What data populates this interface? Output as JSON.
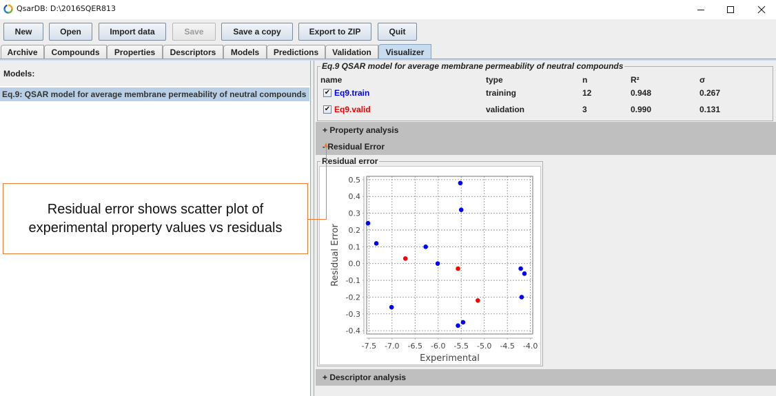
{
  "window": {
    "title": "QsarDB: D:\\2016SQER813",
    "icon": "qsardb-ring-icon",
    "controls": [
      "minimize-icon",
      "maximize-icon",
      "close-icon"
    ]
  },
  "toolbar": {
    "buttons": [
      {
        "label": "New",
        "enabled": true
      },
      {
        "label": "Open",
        "enabled": true
      },
      {
        "label": "Import data",
        "enabled": true
      },
      {
        "label": "Save",
        "enabled": false
      },
      {
        "label": "Save a copy",
        "enabled": true
      },
      {
        "label": "Export to ZIP",
        "enabled": true
      },
      {
        "label": "Quit",
        "enabled": true
      }
    ]
  },
  "tabs": {
    "items": [
      "Archive",
      "Compounds",
      "Properties",
      "Descriptors",
      "Models",
      "Predictions",
      "Validation",
      "Visualizer"
    ],
    "active": "Visualizer"
  },
  "left": {
    "label": "Models:",
    "items": [
      "Eq.9: QSAR model for average membrane permeability of neutral compounds"
    ],
    "selected": 0
  },
  "model": {
    "title": "Eq.9 QSAR model for average membrane permeability of neutral compounds",
    "headers": [
      "name",
      "type",
      "n",
      "R²",
      "σ"
    ],
    "rows": [
      {
        "name": "Eq9.train",
        "type": "training",
        "n": "12",
        "r2": "0.948",
        "sigma": "0.267",
        "checked": true,
        "color": "#0000ee"
      },
      {
        "name": "Eq9.valid",
        "type": "validation",
        "n": "3",
        "r2": "0.990",
        "sigma": "0.131",
        "checked": true,
        "color": "#ee0000"
      }
    ]
  },
  "sections": {
    "property_analysis": "+ Property analysis",
    "residual_error": "- Residual Error",
    "descriptor_analysis": "+ Descriptor analysis"
  },
  "plot_panel_title": "Residual error",
  "annotation": {
    "text": "Residual error shows scatter plot of experimental property values vs residuals",
    "border_color": "#ed7d31"
  },
  "chart_data": {
    "type": "scatter",
    "title": "Residual error",
    "xlabel": "Experimental",
    "ylabel": "Residual Error",
    "xlim": [
      -7.55,
      -3.95
    ],
    "ylim": [
      -0.42,
      0.52
    ],
    "xticks": [
      -7.5,
      -7.0,
      -6.5,
      -6.0,
      -5.5,
      -5.0,
      -4.5,
      -4.0
    ],
    "xtick_labels": [
      "-7.5",
      "-7.0",
      "-6.5",
      "-6.0",
      "-5.5",
      "-5.0",
      "-4.5",
      "-4.0"
    ],
    "yticks": [
      0.5,
      0.4,
      0.3,
      0.2,
      0.1,
      0.0,
      -0.1,
      -0.2,
      -0.3,
      -0.4
    ],
    "ytick_labels": [
      "0.5",
      "0.4",
      "0.3",
      "0.2",
      "0.1",
      "0.0",
      "-0.1",
      "-0.2",
      "-0.3",
      "-0.4"
    ],
    "grid": true,
    "series": [
      {
        "name": "Eq9.train",
        "color": "#0000ff",
        "points": [
          [
            -7.52,
            0.24
          ],
          [
            -7.34,
            0.12
          ],
          [
            -7.01,
            -0.26
          ],
          [
            -6.27,
            0.1
          ],
          [
            -6.01,
            0.0
          ],
          [
            -5.52,
            0.48
          ],
          [
            -5.5,
            0.32
          ],
          [
            -5.57,
            -0.37
          ],
          [
            -5.46,
            -0.35
          ],
          [
            -4.21,
            -0.03
          ],
          [
            -4.13,
            -0.06
          ],
          [
            -4.19,
            -0.2
          ]
        ]
      },
      {
        "name": "Eq9.valid",
        "color": "#ff0000",
        "points": [
          [
            -6.71,
            0.03
          ],
          [
            -5.57,
            -0.03
          ],
          [
            -5.14,
            -0.22
          ]
        ]
      }
    ]
  }
}
